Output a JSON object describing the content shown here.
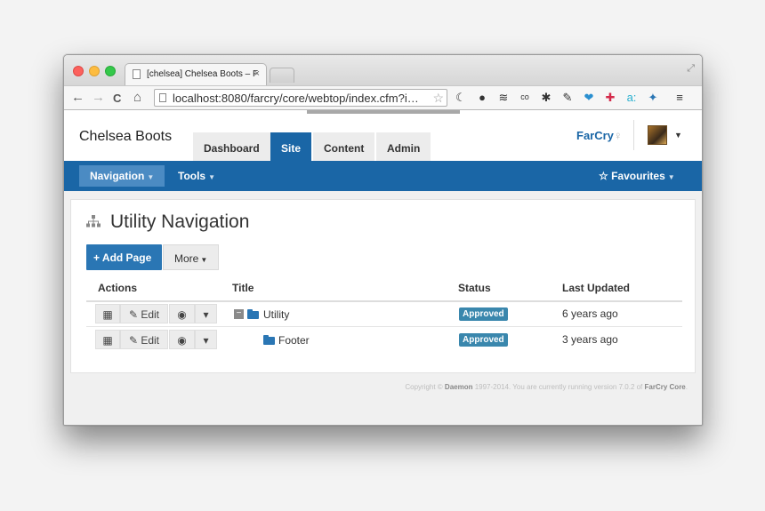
{
  "browser": {
    "tab_title": "[chelsea] Chelsea Boots – F",
    "tab_close": "×",
    "url": "localhost:8080/farcry/core/webtop/index.cfm?i…",
    "back": "←",
    "forward": "→",
    "reload": "C",
    "home": "⌂",
    "bookmark_star": "☆",
    "menu": "≡",
    "fullscreen": "⤢",
    "extensions": [
      "☾",
      "●",
      "≋",
      "co",
      "✱",
      "✎",
      "❤",
      "✚",
      "a:",
      "✦"
    ]
  },
  "header": {
    "site_name": "Chelsea Boots",
    "tabs": [
      {
        "label": "Dashboard"
      },
      {
        "label": "Site"
      },
      {
        "label": "Content"
      },
      {
        "label": "Admin"
      }
    ],
    "active_tab": "Site",
    "brand": "FarCry",
    "brand_glyph": "♀",
    "avatar_caret": "▼"
  },
  "subnav": {
    "navigation": "Navigation",
    "tools": "Tools",
    "favourites": "☆ Favourites",
    "caret": "▼"
  },
  "main": {
    "title": "Utility Navigation",
    "title_icon": "sitemap-icon",
    "add_button": "+ Add Page",
    "more_button": "More",
    "more_caret": "▼",
    "columns": [
      "Actions",
      "Title",
      "Status",
      "Last Updated"
    ],
    "rows": [
      {
        "grid": "▦",
        "edit": "✎ Edit",
        "view": "◉",
        "dropdown": "▾",
        "collapse": "−",
        "title": "Utility",
        "status": "Approved",
        "updated": "6 years ago"
      },
      {
        "grid": "▦",
        "edit": "✎ Edit",
        "view": "◉",
        "dropdown": "▾",
        "title": "Footer",
        "status": "Approved",
        "updated": "3 years ago"
      }
    ]
  },
  "footer": {
    "prefix": "Copyright © ",
    "company": "Daemon",
    "middle": " 1997-2014. You are currently running version 7.0.2 of ",
    "product": "FarCry Core",
    "suffix": "."
  },
  "colors": {
    "primary": "#1a66a6",
    "badge": "#3a87ad",
    "button": "#2a76b4"
  }
}
